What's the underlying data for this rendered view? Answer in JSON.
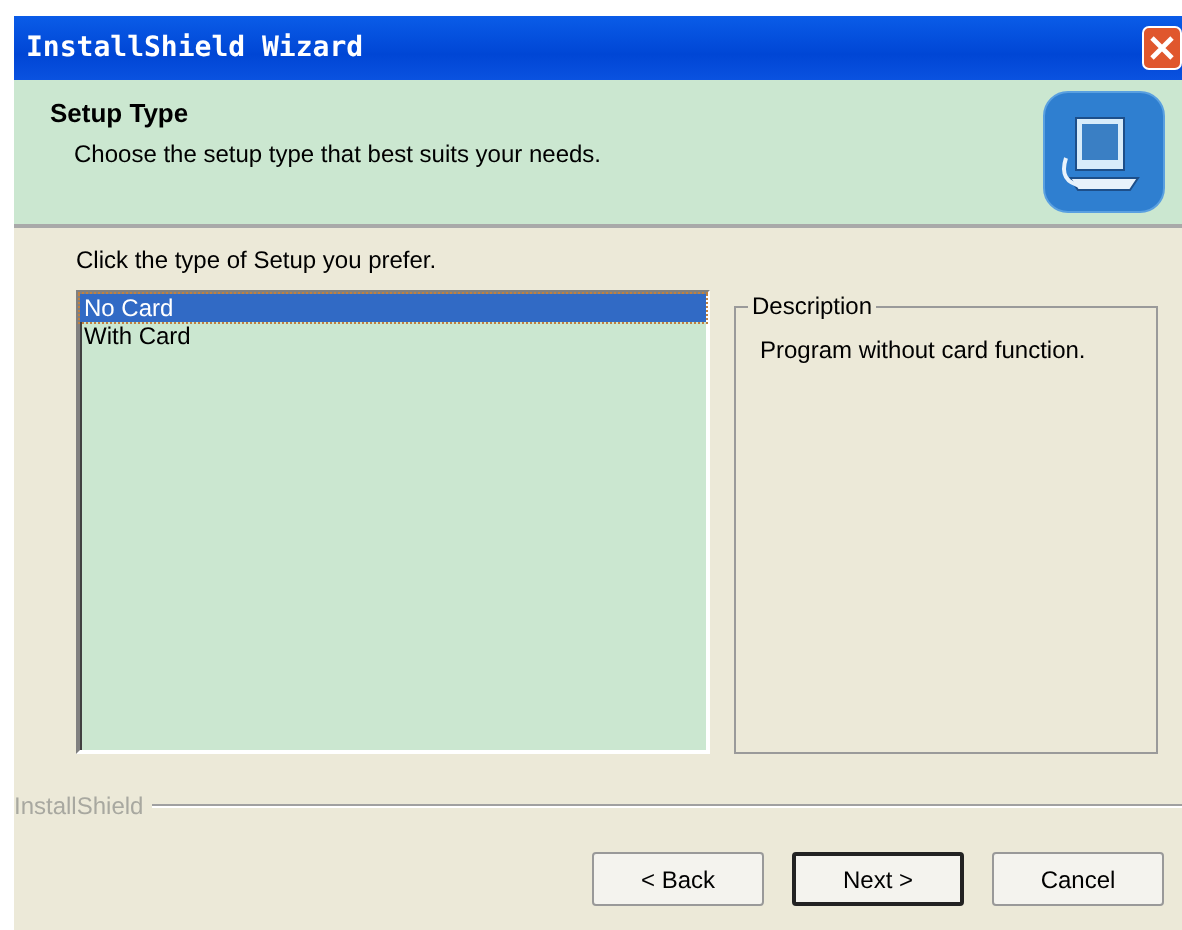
{
  "window": {
    "title": "InstallShield Wizard"
  },
  "header": {
    "title": "Setup Type",
    "subtitle": "Choose the setup type that best suits your needs."
  },
  "prompt": "Click the type of Setup you prefer.",
  "setup_types": [
    {
      "label": "No Card",
      "selected": true
    },
    {
      "label": "With Card",
      "selected": false
    }
  ],
  "description": {
    "title": "Description",
    "text": "Program without card function."
  },
  "footer_brand": "InstallShield",
  "buttons": [
    {
      "label": "< Back",
      "default": false
    },
    {
      "label": "Next >",
      "default": true
    },
    {
      "label": "Cancel",
      "default": false
    }
  ]
}
